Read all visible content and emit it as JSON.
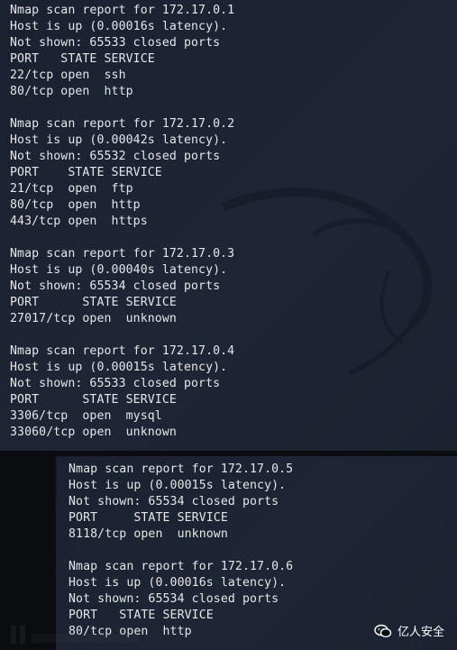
{
  "top_lines": [
    "Nmap scan report for 172.17.0.1",
    "Host is up (0.00016s latency).",
    "Not shown: 65533 closed ports",
    "PORT   STATE SERVICE",
    "22/tcp open  ssh",
    "80/tcp open  http",
    "",
    "Nmap scan report for 172.17.0.2",
    "Host is up (0.00042s latency).",
    "Not shown: 65532 closed ports",
    "PORT    STATE SERVICE",
    "21/tcp  open  ftp",
    "80/tcp  open  http",
    "443/tcp open  https",
    "",
    "Nmap scan report for 172.17.0.3",
    "Host is up (0.00040s latency).",
    "Not shown: 65534 closed ports",
    "PORT      STATE SERVICE",
    "27017/tcp open  unknown",
    "",
    "Nmap scan report for 172.17.0.4",
    "Host is up (0.00015s latency).",
    "Not shown: 65533 closed ports",
    "PORT      STATE SERVICE",
    "3306/tcp  open  mysql",
    "33060/tcp open  unknown"
  ],
  "bottom_lines": [
    "Nmap scan report for 172.17.0.5",
    "Host is up (0.00015s latency).",
    "Not shown: 65534 closed ports",
    "PORT     STATE SERVICE",
    "8118/tcp open  unknown",
    "",
    "Nmap scan report for 172.17.0.6",
    "Host is up (0.00016s latency).",
    "Not shown: 65534 closed ports",
    "PORT   STATE SERVICE",
    "80/tcp open  http"
  ],
  "watermark": {
    "text": "亿人安全",
    "icon": "wechat-icon"
  },
  "colors": {
    "terminal_bg": "#1e2636",
    "text": "#e6e6e6",
    "page_bg": "#0b0c10"
  }
}
